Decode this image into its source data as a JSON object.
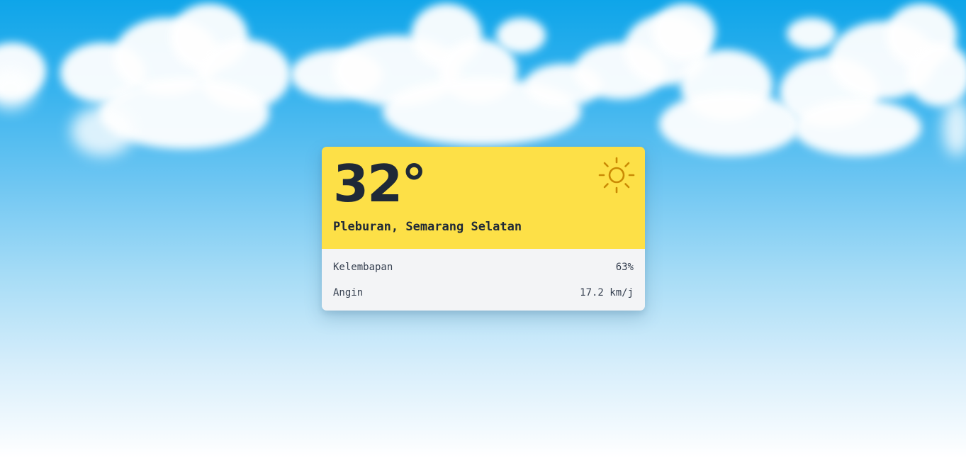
{
  "weather": {
    "temperature": "32°",
    "location": "Pleburan, Semarang Selatan",
    "condition_icon": "sun-icon",
    "icon_color": "#ca8a04",
    "card_accent": "#fde047"
  },
  "details": [
    {
      "label": "Kelembapan",
      "value": "63%"
    },
    {
      "label": "Angin",
      "value": "17.2 km/j"
    }
  ],
  "background": {
    "sky_top": "#0ea5e9",
    "sky_bottom": "#ffffff"
  }
}
